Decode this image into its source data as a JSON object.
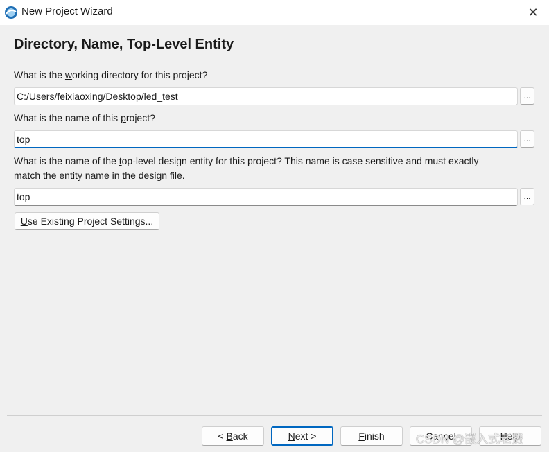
{
  "window": {
    "title": "New Project Wizard",
    "close_glyph": "✕"
  },
  "page": {
    "title": "Directory, Name, Top-Level Entity"
  },
  "fields": {
    "directory": {
      "label_pre": "What is the ",
      "label_mnemonic": "w",
      "label_post": "orking directory for this project?",
      "value": "C:/Users/feixiaoxing/Desktop/led_test",
      "browse_label": "..."
    },
    "project_name": {
      "label_pre": "What is the name of this ",
      "label_mnemonic": "p",
      "label_post": "roject?",
      "value": "top",
      "browse_label": "..."
    },
    "top_entity": {
      "label_pre": "What is the name of the ",
      "label_mnemonic": "t",
      "label_post": "op-level design entity for this project? This name is case sensitive and must exactly",
      "label_line2": "match the entity name in the design file.",
      "value": "top",
      "browse_label": "..."
    }
  },
  "settings_button": {
    "mnemonic": "U",
    "rest": "se Existing Project Settings..."
  },
  "footer": {
    "back": {
      "pre": "< ",
      "mnemonic": "B",
      "post": "ack"
    },
    "next": {
      "pre": "",
      "mnemonic": "N",
      "post": "ext >"
    },
    "finish": {
      "pre": "",
      "mnemonic": "F",
      "post": "inish"
    },
    "cancel": "Cancel",
    "help": "Help"
  },
  "watermark": "CSDN @嵌入式老费",
  "colors": {
    "accent": "#0067c0",
    "background": "#f0f0f0"
  }
}
